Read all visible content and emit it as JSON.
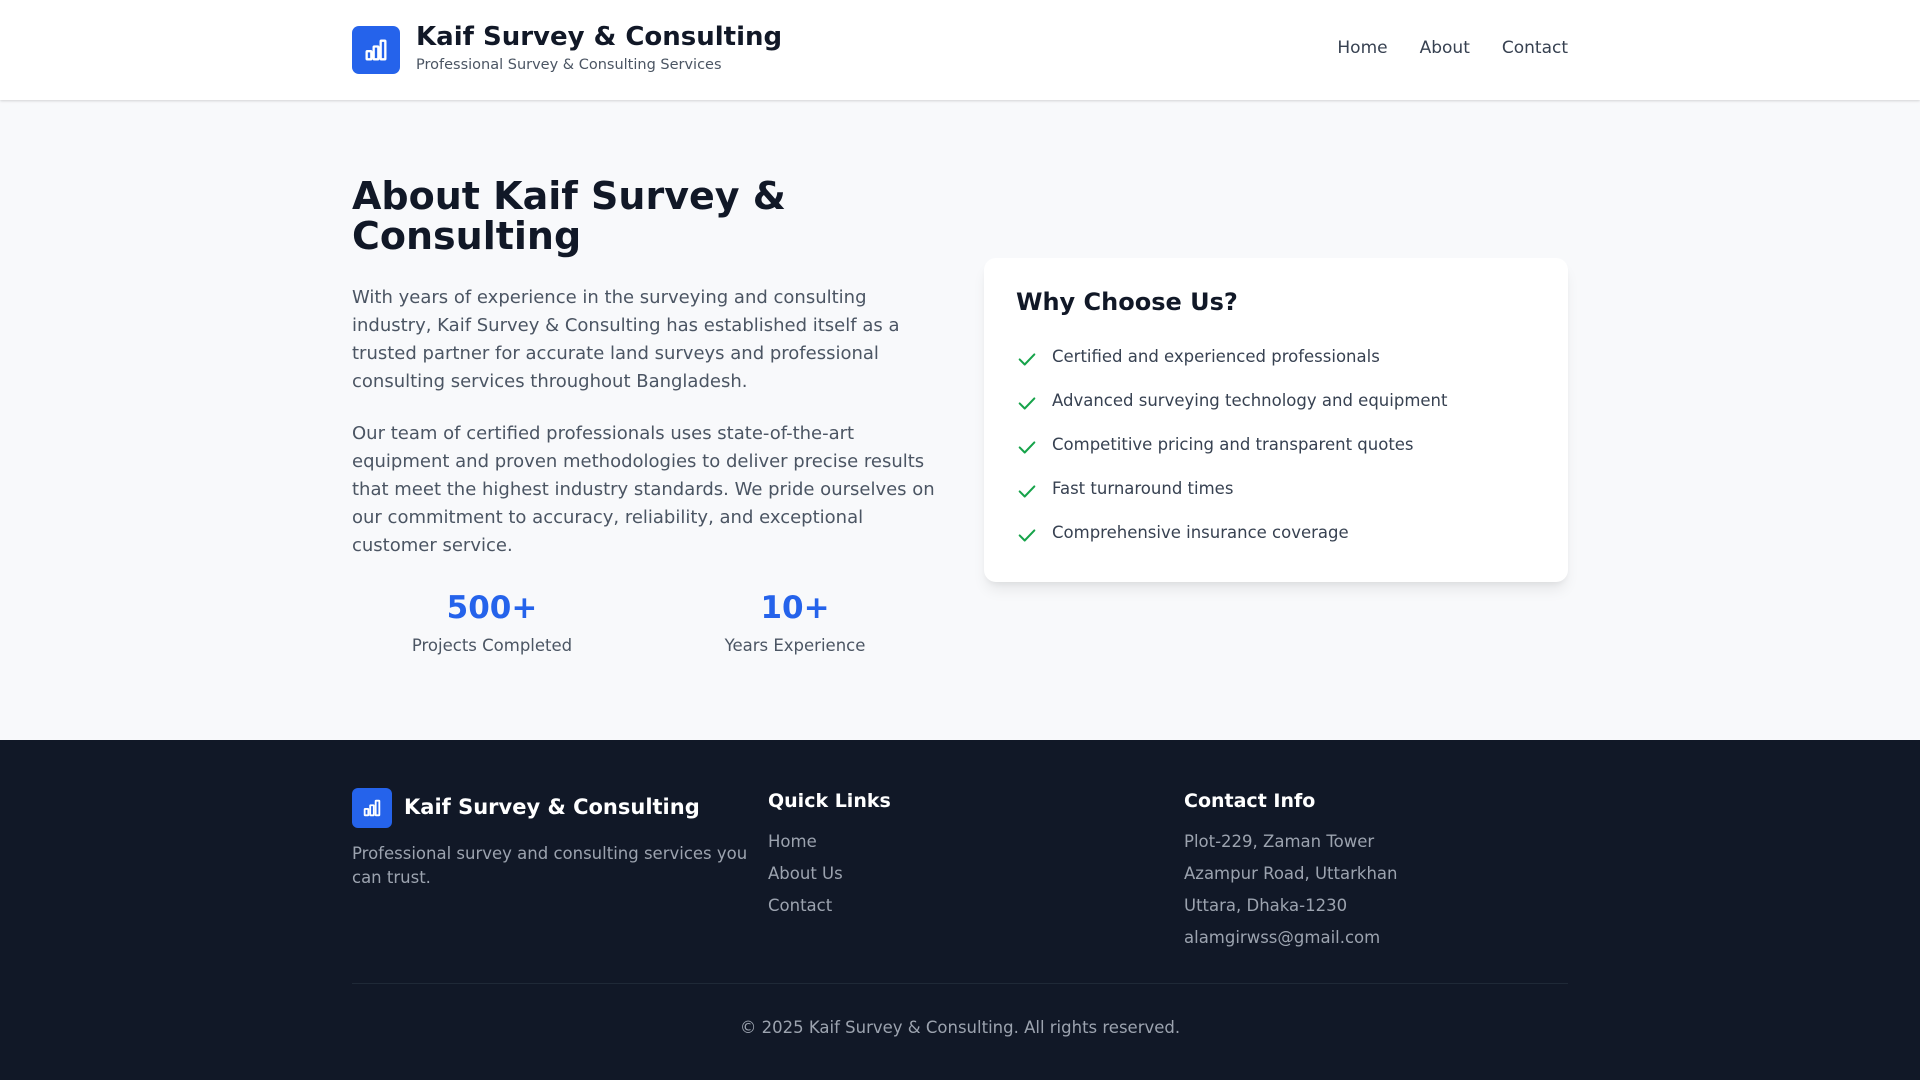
{
  "header": {
    "logo_icon": "bar-chart-icon",
    "brand_title": "Kaif Survey & Consulting",
    "brand_tagline": "Professional Survey & Consulting Services",
    "nav": [
      {
        "label": "Home"
      },
      {
        "label": "About"
      },
      {
        "label": "Contact"
      }
    ]
  },
  "about": {
    "title": "About Kaif Survey & Consulting",
    "paragraphs": [
      "With years of experience in the surveying and consulting industry, Kaif Survey & Consulting has established itself as a trusted partner for accurate land surveys and professional consulting services throughout Bangladesh.",
      "Our team of certified professionals uses state-of-the-art equipment and proven methodologies to deliver precise results that meet the highest industry standards. We pride ourselves on our commitment to accuracy, reliability, and exceptional customer service."
    ],
    "stats": [
      {
        "value": "500+",
        "label": "Projects Completed"
      },
      {
        "value": "10+",
        "label": "Years Experience"
      }
    ]
  },
  "why_choose": {
    "title": "Why Choose Us?",
    "check_icon": "check-icon",
    "check_color": "#16a34a",
    "features": [
      "Certified and experienced professionals",
      "Advanced surveying technology and equipment",
      "Competitive pricing and transparent quotes",
      "Fast turnaround times",
      "Comprehensive insurance coverage"
    ]
  },
  "footer": {
    "brand": "Kaif Survey & Consulting",
    "description": "Professional survey and consulting services you can trust.",
    "quick_links_title": "Quick Links",
    "quick_links": [
      "Home",
      "About Us",
      "Contact"
    ],
    "contact_title": "Contact Info",
    "contact_lines": [
      "Plot-229, Zaman Tower",
      "Azampur Road, Uttarkhan",
      "Uttara, Dhaka-1230",
      "alamgirwss@gmail.com"
    ],
    "copyright": "© 2025 Kaif Survey & Consulting. All rights reserved."
  },
  "colors": {
    "accent": "#2563eb",
    "footer_bg": "#111827",
    "page_bg": "#f8f9fb"
  }
}
